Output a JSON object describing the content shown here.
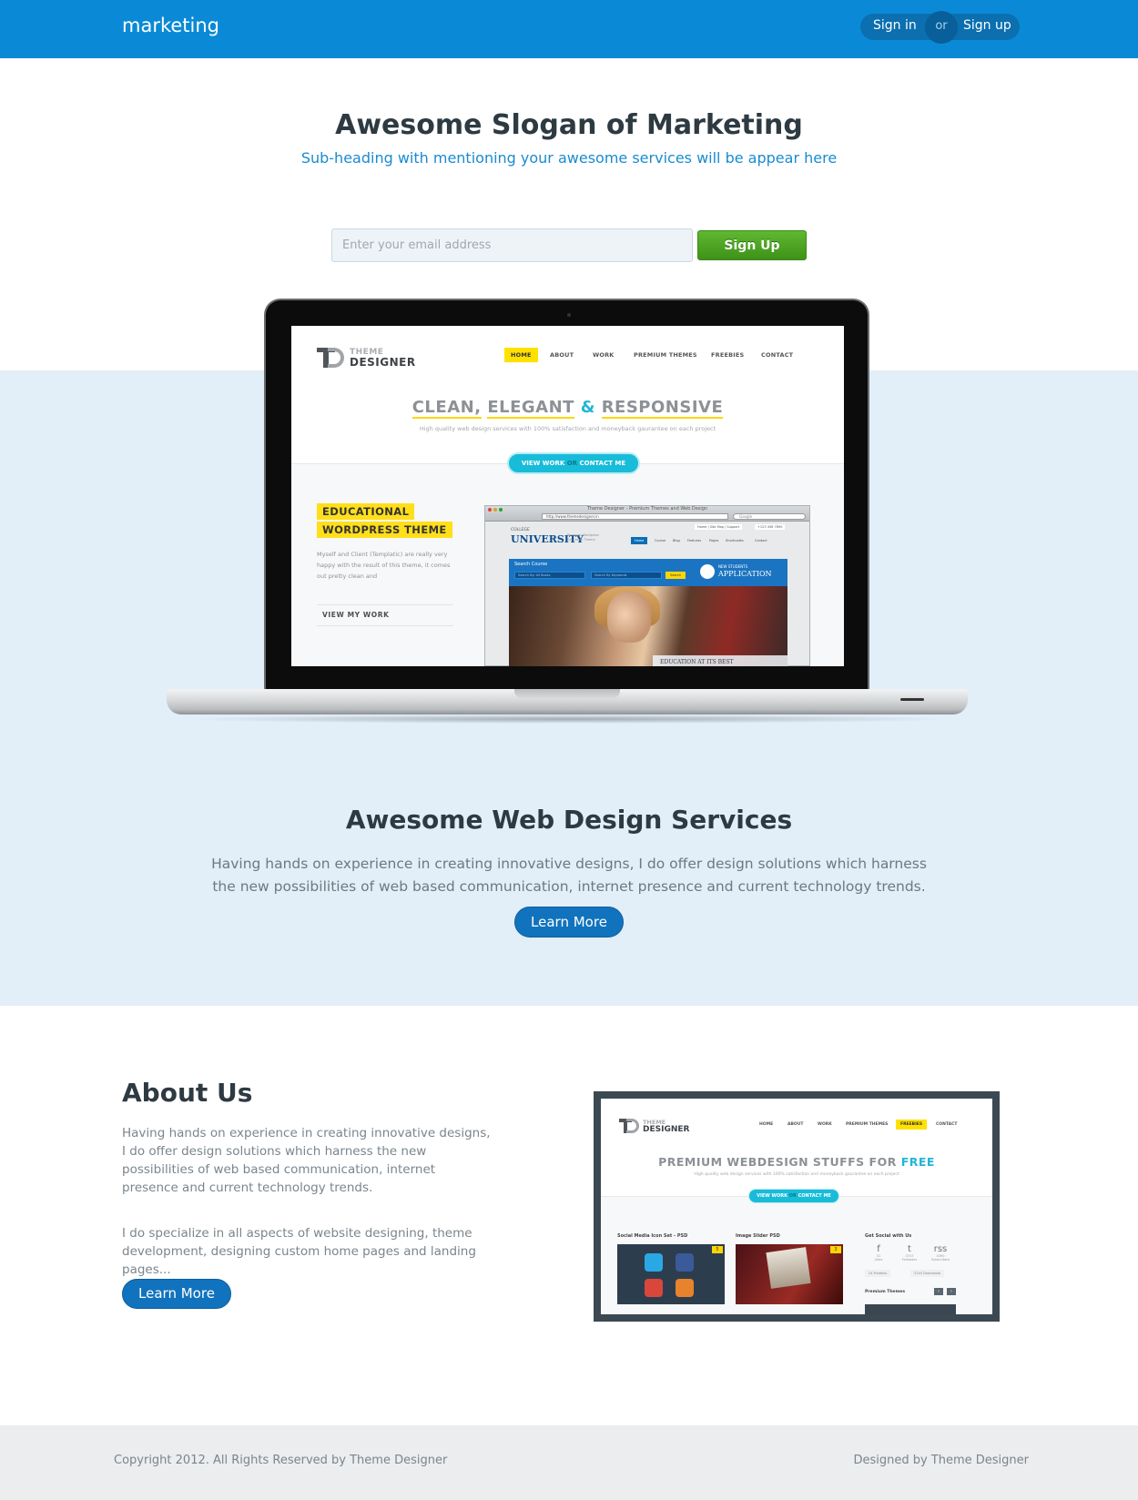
{
  "header": {
    "brand": "marketing",
    "sign_in": "Sign in",
    "or": "or",
    "sign_up": "Sign up",
    "bg_color": "#0a8ad6"
  },
  "hero": {
    "title": "Awesome Slogan of Marketing",
    "subtitle": "Sub-heading with mentioning your awesome services will be appear here",
    "email_placeholder": "Enter your email address",
    "signup_label": "Sign Up"
  },
  "laptop_screen": {
    "logo_line1": "THEME",
    "logo_line2": "DESIGNER",
    "nav": [
      "HOME",
      "ABOUT",
      "WORK",
      "PREMIUM THEMES",
      "FREEBIES",
      "CONTACT"
    ],
    "tagline_w1": "CLEAN,",
    "tagline_w2": "ELEGANT",
    "tagline_amp": "&",
    "tagline_w3": "RESPONSIVE",
    "tagline_sub": "High quality web design services with 100% satisfaction and moneyback gaurantee on each project",
    "cta_view": "VIEW WORK",
    "cta_or": "OR",
    "cta_contact": "CONTACT ME",
    "badge1": "EDUCATIONAL",
    "badge2": "WORDPRESS THEME",
    "body": "Myself and Client (Templatic) are really very happy with the result of this theme, it comes out pretty clean and",
    "view_my_work": "VIEW MY WORK",
    "browser": {
      "title": "Theme Designer - Premium Themes and Web Design",
      "url": "http://www.themedesigner.in",
      "search": "Google",
      "college": "COLLEGE",
      "university": "UNIVERSITY",
      "univ_sub": "Premium Wordpress Education Theme",
      "top_links": "Home | Site Map | Support",
      "phone": "+123 456 7890",
      "nav": [
        "Home",
        "Course",
        "Blog",
        "Features",
        "Pages",
        "Shortcodes",
        "Contact"
      ],
      "search_course": "Search Course",
      "field1": "Search By: All Books",
      "field2": "Search By Keywords",
      "search_btn": "Search",
      "new_students": "NEW STUDENTS",
      "application": "APPLICATION",
      "caption": "EDUCATION AT ITS BEST"
    }
  },
  "services": {
    "title": "Awesome Web Design Services",
    "text": "Having hands on experience in creating innovative designs, I do offer design solutions which harness the new possibilities of web based communication, internet presence and current technology trends.",
    "button": "Learn More",
    "band_color": "#e2eef8"
  },
  "about": {
    "title": "About Us",
    "p1": "Having hands on experience in creating innovative designs, I do offer design solutions which harness the new possibilities of web based communication, internet presence and current technology trends.",
    "p2": "I do specialize in all aspects of website designing, theme development, designing custom home pages and landing pages...",
    "button": "Learn More",
    "shot": {
      "logo_line1": "THEME",
      "logo_line2": "DESIGNER",
      "nav": [
        "HOME",
        "ABOUT",
        "WORK",
        "PREMIUM THEMES",
        "FREEBIES",
        "CONTACT"
      ],
      "tagline_main": "PREMIUM WEBDESIGN STUFFS FOR",
      "tagline_free": "FREE",
      "tagline_sub": "High quality web design services with 100% satisfaction and moneyback gaurantee on each project",
      "cta_view": "VIEW WORK",
      "cta_or": "OR",
      "cta_contact": "CONTACT ME",
      "label1": "Social Media Icon Set - PSD",
      "label2": "Image Slider PSD",
      "label3": "Get Social with Us",
      "fav1": "5",
      "fav2": "3",
      "social": [
        {
          "icon": "f",
          "count": "31",
          "label": "Likes"
        },
        {
          "icon": "t",
          "count": "3747",
          "label": "Followers"
        },
        {
          "icon": "rss",
          "count": "4390",
          "label": "Subscribers"
        }
      ],
      "stat1": "24 Freebies",
      "stat2": "3144 Downloads",
      "premium_themes": "Premium Themes"
    }
  },
  "footer": {
    "copyright": "Copyright 2012. All Rights Reserved by Theme Designer",
    "designed_by": "Designed by Theme Designer"
  }
}
